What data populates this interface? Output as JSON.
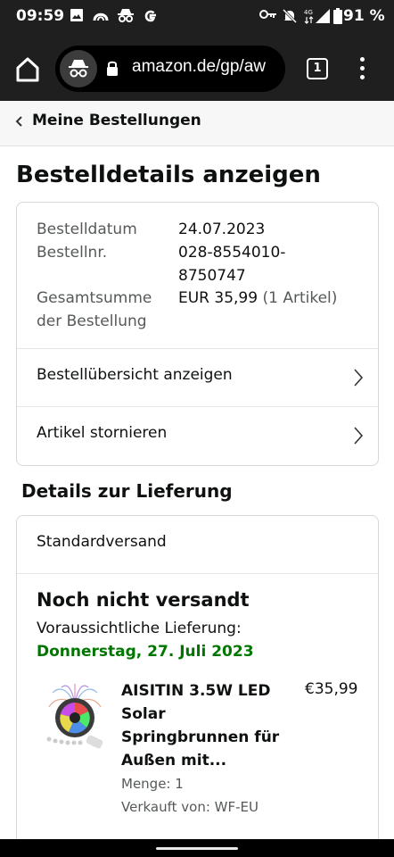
{
  "status_bar": {
    "time": "09:59",
    "battery": "91 %",
    "icons": [
      "gallery-icon",
      "app-icon",
      "incognito-icon",
      "google-icon",
      "vpn-key-icon",
      "mute-icon",
      "4g-lte-icon",
      "signal-icon",
      "battery-icon"
    ]
  },
  "browser": {
    "url": "amazon.de/gp/aw",
    "tab_count": "1"
  },
  "breadcrumb": {
    "label": "Meine Bestellungen"
  },
  "page": {
    "title": "Bestelldetails anzeigen"
  },
  "order": {
    "date_label": "Bestelldatum",
    "date_value": "24.07.2023",
    "number_label": "Bestellnr.",
    "number_value_line1": "028-8554010-",
    "number_value_line2": "8750747",
    "total_label_line1": "Gesamtsumme",
    "total_label_line2": "der Bestellung",
    "total_value": "EUR 35,99",
    "total_items": "(1 Artikel)",
    "link_summary": "Bestellübersicht anzeigen",
    "link_cancel": "Artikel stornieren"
  },
  "delivery": {
    "section_title": "Details zur Lieferung",
    "method": "Standardversand",
    "status": "Noch nicht versandt",
    "expected_label": "Voraussichtliche Lieferung:",
    "expected_date": "Donnerstag, 27. Juli 2023"
  },
  "product": {
    "title_lines": [
      "AISITIN 3.5W LED",
      "Solar",
      "Springbrunnen für",
      "Außen mit..."
    ],
    "price": "€35,99",
    "quantity": "Menge: 1",
    "seller": "Verkauft von: WF-EU"
  },
  "colors": {
    "delivery_green": "#007600",
    "browser_dark": "#1f1f1f",
    "muted_text": "#565959"
  }
}
